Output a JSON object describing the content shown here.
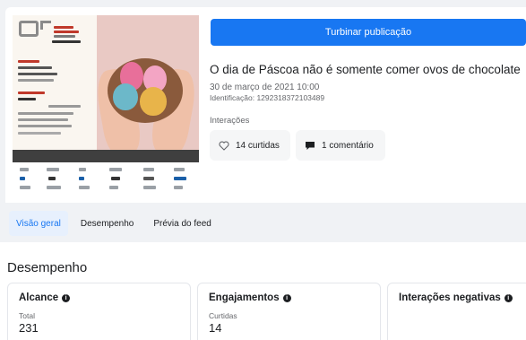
{
  "boost_button": "Turbinar publicação",
  "post": {
    "title": "O dia de Páscoa não é somente comer ovos de chocolate",
    "date": "30 de março de 2021 10:00",
    "id": "Identificação: 1292318372103489",
    "interactions_label": "Interações",
    "likes": "14 curtidas",
    "comments": "1 comentário"
  },
  "tabs": [
    "Visão geral",
    "Desempenho",
    "Prévia do feed"
  ],
  "performance": {
    "title": "Desempenho",
    "metrics": [
      {
        "title": "Alcance",
        "sub": "Total",
        "value": "231"
      },
      {
        "title": "Engajamentos",
        "sub": "Curtidas",
        "value": "14"
      },
      {
        "title": "Interações negativas",
        "sub": "",
        "value": ""
      }
    ]
  },
  "colors": {
    "accent": "#1877f2",
    "background": "#f0f2f5"
  }
}
